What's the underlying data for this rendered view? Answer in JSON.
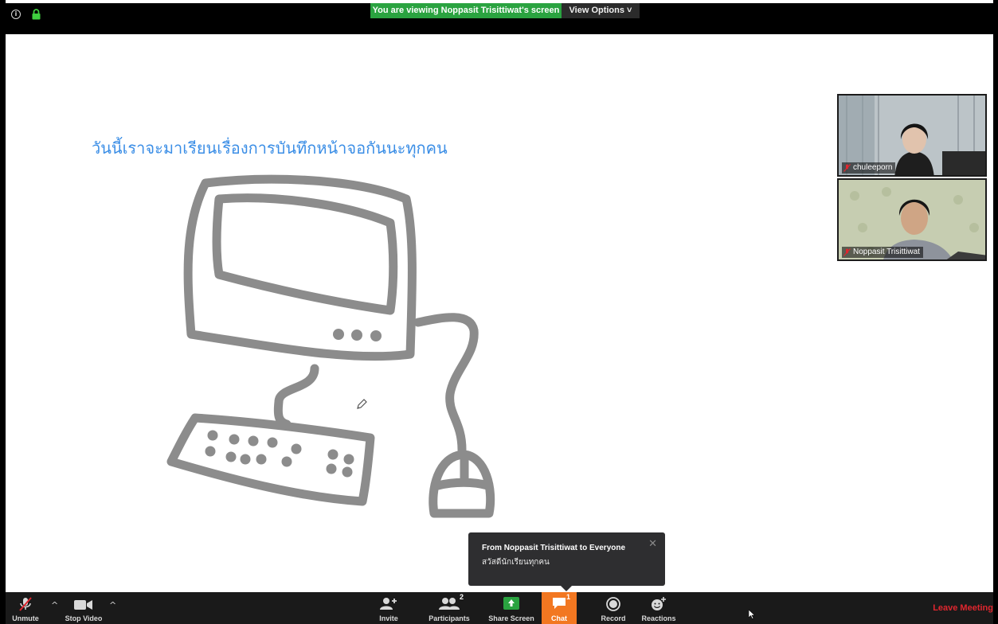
{
  "top_bar": {
    "viewing_banner": "You are viewing Noppasit Trisittiwat's screen",
    "view_options_label": "View Options ˅"
  },
  "whiteboard": {
    "title_text": "วันนี้เราจะมาเรียนเรื่องการบันทึกหน้าจอกันนะทุกคน"
  },
  "participants_videos": [
    {
      "name": "chuleeporn",
      "muted": true
    },
    {
      "name": "Noppasit Trisittiwat",
      "muted": true
    }
  ],
  "chat_notification": {
    "sender": "From Noppasit Trisittiwat to Everyone",
    "message": "สวัสดีนักเรียนทุกคน",
    "close": "✕"
  },
  "toolbar": {
    "unmute": "Unmute",
    "stop_video": "Stop Video",
    "caret": "^",
    "invite": "Invite",
    "participants": "Participants",
    "participants_count": "2",
    "share_screen": "Share Screen",
    "chat": "Chat",
    "chat_badge": "1",
    "record": "Record",
    "reactions": "Reactions",
    "leave_meeting": "Leave Meeting"
  },
  "colors": {
    "banner_green": "#2aa340",
    "chat_orange": "#f27721",
    "leave_red": "#e0262e",
    "title_blue": "#3b8ee6",
    "drawing_gray": "#8c8c8c"
  }
}
